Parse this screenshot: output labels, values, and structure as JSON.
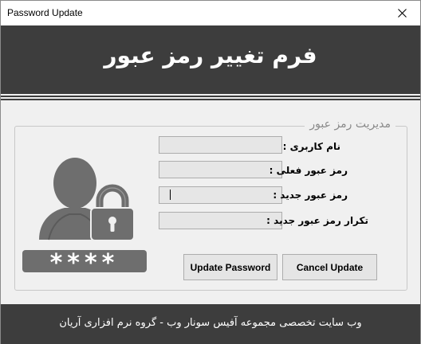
{
  "window": {
    "title": "Password Update"
  },
  "header": {
    "title": "فرم تغییر رمز عبور"
  },
  "group": {
    "legend": "مدیریت رمز عبور"
  },
  "fields": [
    {
      "label": "نام کاربری :",
      "value": ""
    },
    {
      "label": "رمز عبور فعلی :",
      "value": ""
    },
    {
      "label": "رمز عبور جدید :",
      "value": ""
    },
    {
      "label": "تکرار رمز عبور جدید :",
      "value": ""
    }
  ],
  "buttons": {
    "update": "Update Password",
    "cancel": "Cancel Update"
  },
  "masked_text": "****",
  "footer": {
    "text": "وب سایت تخصصی مجموعه آفیس سونار وب - گروه نرم افزاری آریان"
  },
  "icons": {
    "close": "close-icon",
    "user": "user-icon",
    "lock": "lock-icon"
  },
  "colors": {
    "header_bg": "#3d3d3d",
    "window_bg": "#f0f0f0",
    "input_bg": "#e6e6e6",
    "accent_gray": "#6e6e6e"
  }
}
